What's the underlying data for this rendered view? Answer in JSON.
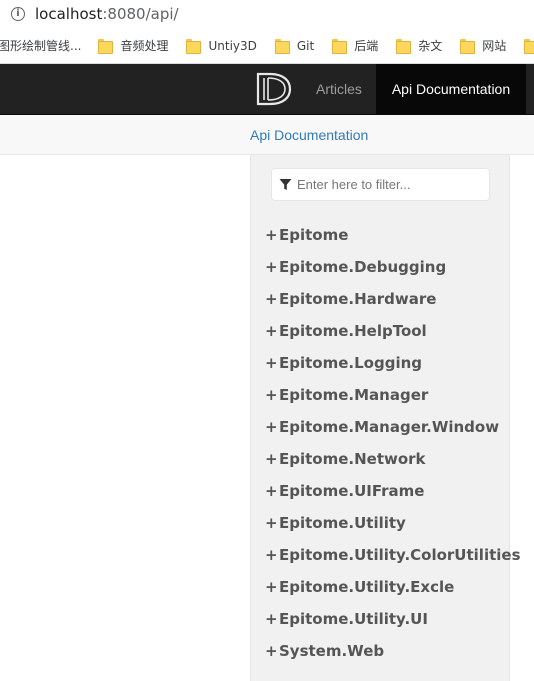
{
  "browser": {
    "url_host": "localhost",
    "url_rest": ":8080/api/",
    "info_icon": "info-icon",
    "info_glyph": "i"
  },
  "bookmarks": [
    {
      "label": "图形绘制管线...",
      "icon": "folder-icon"
    },
    {
      "label": "音频处理",
      "icon": "folder-icon"
    },
    {
      "label": "Untiy3D",
      "icon": "folder-icon"
    },
    {
      "label": "Git",
      "icon": "folder-icon"
    },
    {
      "label": "后端",
      "icon": "folder-icon"
    },
    {
      "label": "杂文",
      "icon": "folder-icon"
    },
    {
      "label": "网站",
      "icon": "folder-icon"
    }
  ],
  "navbar": {
    "brand_icon": "docfx-logo-icon",
    "articles_label": "Articles",
    "apidoc_label": "Api Documentation"
  },
  "subnav": {
    "breadcrumb_label": "Api Documentation"
  },
  "sidebar": {
    "filter_placeholder": "Enter here to filter...",
    "filter_icon": "filter-icon",
    "expand_glyph": "+",
    "namespaces": [
      "Epitome",
      "Epitome.Debugging",
      "Epitome.Hardware",
      "Epitome.HelpTool",
      "Epitome.Logging",
      "Epitome.Manager",
      "Epitome.Manager.Window",
      "Epitome.Network",
      "Epitome.UIFrame",
      "Epitome.Utility",
      "Epitome.Utility.ColorUtilities",
      "Epitome.Utility.Excle",
      "Epitome.Utility.UI",
      "System.Web"
    ]
  },
  "colors": {
    "navbar_bg": "#222222",
    "active_tab_bg": "#080808",
    "link": "#337ab7",
    "sidebar_bg": "#f1f1f1"
  }
}
